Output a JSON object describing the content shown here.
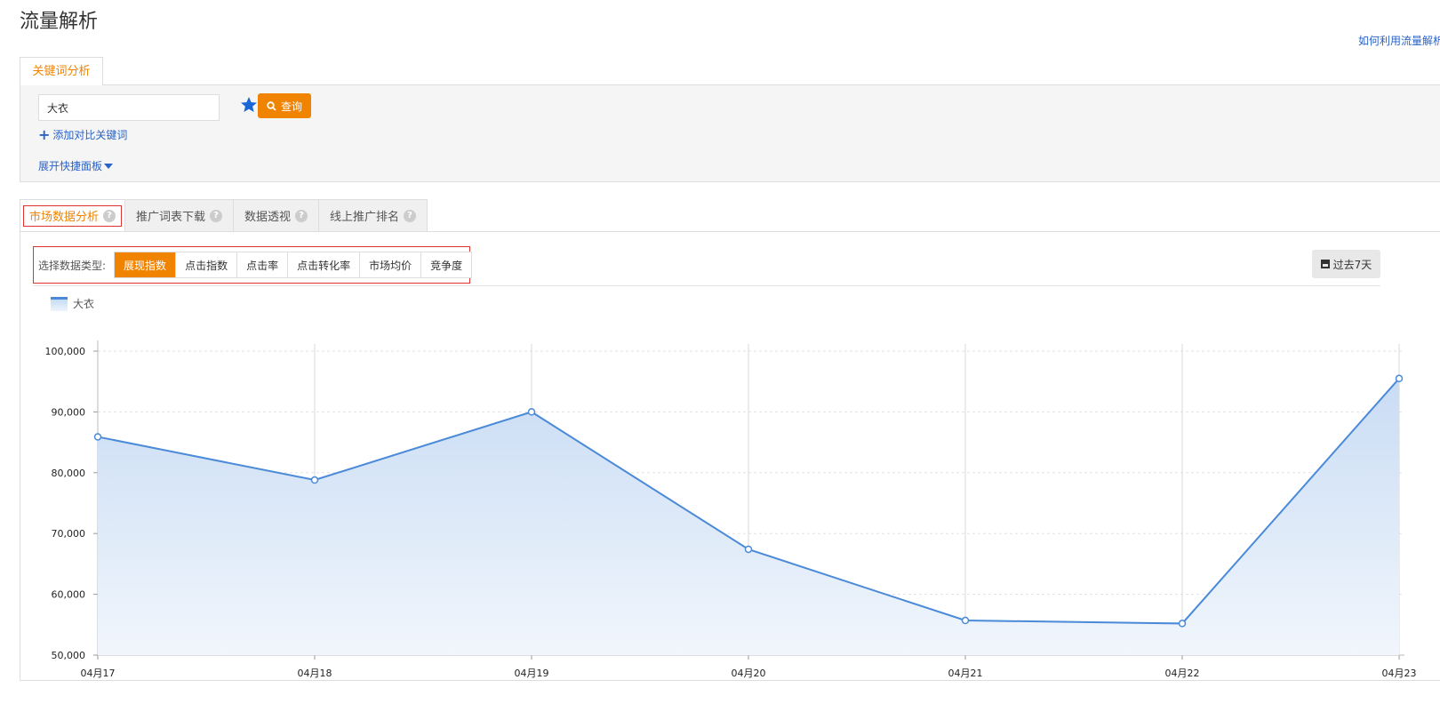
{
  "header": {
    "title": "流量解析",
    "help_link": "如何利用流量解析"
  },
  "keyword_tab": {
    "label": "关键词分析"
  },
  "search": {
    "value": "大衣",
    "query_label": "查询",
    "add_compare_label": "添加对比关键词",
    "expand_panel_label": "展开快捷面板"
  },
  "tabs": [
    {
      "label": "市场数据分析"
    },
    {
      "label": "推广词表下载"
    },
    {
      "label": "数据透视"
    },
    {
      "label": "线上推广排名"
    }
  ],
  "data_type": {
    "label": "选择数据类型:",
    "options": [
      "展现指数",
      "点击指数",
      "点击率",
      "点击转化率",
      "市场均价",
      "竞争度"
    ],
    "selected": "展现指数"
  },
  "period": {
    "label": "过去7天"
  },
  "colors": {
    "accent": "#f08300",
    "link": "#2a63c8",
    "series": "#4a8ad8"
  },
  "chart_data": {
    "type": "area",
    "x": [
      "04月17",
      "04月18",
      "04月19",
      "04月20",
      "04月21",
      "04月22",
      "04月23"
    ],
    "series": [
      {
        "name": "大衣",
        "values": [
          85900,
          78800,
          90000,
          67400,
          55700,
          55200,
          95500
        ]
      }
    ],
    "ylim": [
      50000,
      100000
    ],
    "yticks": [
      50000,
      60000,
      70000,
      80000,
      90000,
      100000
    ],
    "ytick_labels": [
      "50,000",
      "60,000",
      "70,000",
      "80,000",
      "90,000",
      "100,000"
    ],
    "grid": true,
    "legend": "top-left"
  }
}
